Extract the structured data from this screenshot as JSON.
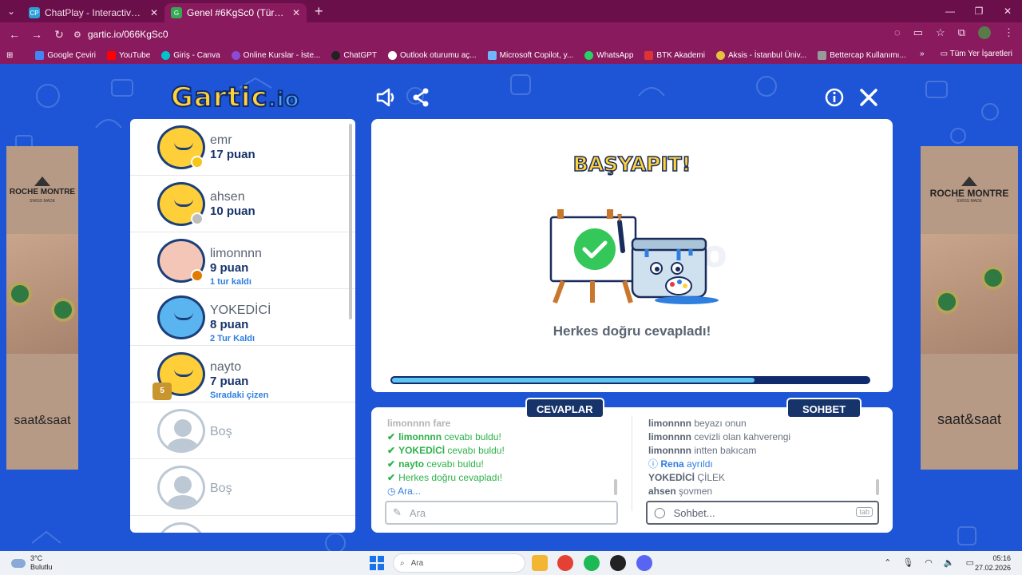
{
  "browser": {
    "tabs": [
      {
        "label": "ChatPlay - Interactive Viewer G",
        "favicon": "CP",
        "active": false
      },
      {
        "label": "Genel #6KgSc0 (Türkçe) - G",
        "favicon": "G",
        "active": true
      }
    ],
    "url": "gartic.io/066KgSc0",
    "bookmarks": [
      "Google Çeviri",
      "YouTube",
      "Giriş - Canva",
      "Online Kurslar - İste...",
      "ChatGPT",
      "Outlook oturumu aç...",
      "Microsoft Copilot, y...",
      "WhatsApp",
      "BTK Akademi",
      "Aksis - İstanbul Üniv...",
      "Bettercap Kullanımı..."
    ],
    "all_bookmarks": "Tüm Yer İşaretleri"
  },
  "game": {
    "logo_main": "Gartic",
    "logo_suffix": ".io",
    "players": [
      {
        "name": "emr",
        "points": "17 puan",
        "sub": "",
        "dot": "#f5c518"
      },
      {
        "name": "ahsen",
        "points": "10 puan",
        "sub": "",
        "dot": "#bdbdbd"
      },
      {
        "name": "limonnnn",
        "points": "9 puan",
        "sub": "1 tur kaldı",
        "dot": "#e07b00"
      },
      {
        "name": "YOKEDİCİ",
        "points": "8 puan",
        "sub": "2 Tur Kaldı",
        "dot": ""
      },
      {
        "name": "nayto",
        "points": "7 puan",
        "sub": "Sıradaki çizen",
        "trophy": "5"
      },
      {
        "name": "Boş"
      },
      {
        "name": "Boş"
      }
    ],
    "masterpiece": "BAŞYAPIT!",
    "status": "Herkes doğru cevapladı!",
    "progress": 0.76,
    "answers_label": "CEVAPLAR",
    "chat_label": "SOHBET",
    "answers": [
      {
        "type": "faded",
        "text": "limonnnn fare"
      },
      {
        "type": "ok",
        "name": "limonnnn",
        "text": "cevabı buldu!"
      },
      {
        "type": "ok",
        "name": "YOKEDİCİ",
        "text": "cevabı buldu!"
      },
      {
        "type": "ok",
        "name": "nayto",
        "text": "cevabı buldu!"
      },
      {
        "type": "ok",
        "name": "",
        "text": "Herkes doğru cevapladı!"
      },
      {
        "type": "info",
        "name": "",
        "text": "Ara..."
      }
    ],
    "chat": [
      {
        "name": "limonnnn",
        "text": "beyazı onun"
      },
      {
        "name": "limonnnn",
        "text": "cevizli olan kahverengi"
      },
      {
        "name": "limonnnn",
        "text": "intten bakıcam"
      },
      {
        "name": "Rena",
        "text": "ayrıldı",
        "info": true
      },
      {
        "name": "YOKEDİCİ",
        "text": "ÇİLEK"
      },
      {
        "name": "ahsen",
        "text": "şovmen"
      }
    ],
    "answer_placeholder": "Ara",
    "chat_placeholder": "Sohbet...",
    "tab_key": "tab"
  },
  "ads": {
    "brand": "ROCHE MONTRE",
    "swiss": "SWISS MADE",
    "store": "saat&saat"
  },
  "taskbar": {
    "temp": "3°C",
    "weather": "Bulutlu",
    "search": "Ara",
    "time": "05:16",
    "date": "27.02.2026"
  }
}
